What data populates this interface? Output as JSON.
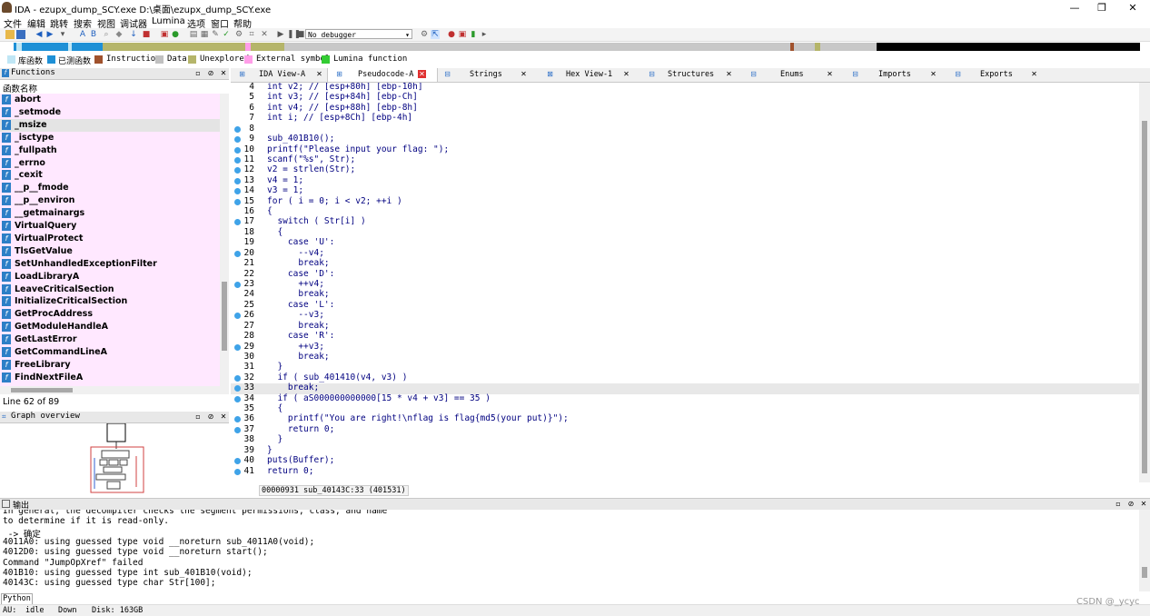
{
  "window": {
    "title": "IDA - ezupx_dump_SCY.exe D:\\桌面\\ezupx_dump_SCY.exe",
    "min": "—",
    "max": "❐",
    "close": "✕"
  },
  "menu": [
    "文件",
    "编辑",
    "跳转",
    "搜索",
    "视图",
    "调试器",
    "Lumina",
    "选项",
    "窗口",
    "帮助"
  ],
  "toolbar": {
    "debugger": "No debugger"
  },
  "legend": [
    {
      "label": "库函数",
      "color": "#bfe6f5"
    },
    {
      "label": "已测函数",
      "color": "#1e90d6"
    },
    {
      "label": "Instruction",
      "color": "#a0522d"
    },
    {
      "label": "Data",
      "color": "#c0c0c0"
    },
    {
      "label": "Unexplored",
      "color": "#b5b56a"
    },
    {
      "label": "External symbol",
      "color": "#ff9ee8"
    },
    {
      "label": "Lumina function",
      "color": "#33cc33"
    }
  ],
  "functions": {
    "title": "Functions",
    "column": "函数名称",
    "items": [
      "abort",
      "_setmode",
      "_msize",
      "_isctype",
      "_fullpath",
      "_errno",
      "_cexit",
      "__p__fmode",
      "__p__environ",
      "__getmainargs",
      "VirtualQuery",
      "VirtualProtect",
      "TlsGetValue",
      "SetUnhandledExceptionFilter",
      "LoadLibraryA",
      "LeaveCriticalSection",
      "InitializeCriticalSection",
      "GetProcAddress",
      "GetModuleHandleA",
      "GetLastError",
      "GetCommandLineA",
      "FreeLibrary",
      "FindNextFileA"
    ],
    "line_info": "Line 62 of 89"
  },
  "graph": {
    "title": "Graph overview"
  },
  "tabs": [
    "IDA View-A",
    "Pseudocode-A",
    "Strings",
    "Hex View-1",
    "Structures",
    "Enums",
    "Imports",
    "Exports"
  ],
  "code": {
    "lines": [
      {
        "n": "4",
        "t": "int v2; // [esp+80h] [ebp-10h]",
        "dot": false
      },
      {
        "n": "5",
        "t": "int v3; // [esp+84h] [ebp-Ch]",
        "dot": false
      },
      {
        "n": "6",
        "t": "int v4; // [esp+88h] [ebp-8h]",
        "dot": false
      },
      {
        "n": "7",
        "t": "int i; // [esp+8Ch] [ebp-4h]",
        "dot": false
      },
      {
        "n": "8",
        "t": "",
        "dot": true
      },
      {
        "n": "9",
        "t": "sub_401B10();",
        "dot": true
      },
      {
        "n": "10",
        "t": "printf(\"Please input your flag: \");",
        "dot": true
      },
      {
        "n": "11",
        "t": "scanf(\"%s\", Str);",
        "dot": true
      },
      {
        "n": "12",
        "t": "v2 = strlen(Str);",
        "dot": true
      },
      {
        "n": "13",
        "t": "v4 = 1;",
        "dot": true
      },
      {
        "n": "14",
        "t": "v3 = 1;",
        "dot": true
      },
      {
        "n": "15",
        "t": "for ( i = 0; i < v2; ++i )",
        "dot": true
      },
      {
        "n": "16",
        "t": "{",
        "dot": false
      },
      {
        "n": "17",
        "t": "  switch ( Str[i] )",
        "dot": true
      },
      {
        "n": "18",
        "t": "  {",
        "dot": false
      },
      {
        "n": "19",
        "t": "    case 'U':",
        "dot": false
      },
      {
        "n": "20",
        "t": "      --v4;",
        "dot": true
      },
      {
        "n": "21",
        "t": "      break;",
        "dot": false
      },
      {
        "n": "22",
        "t": "    case 'D':",
        "dot": false
      },
      {
        "n": "23",
        "t": "      ++v4;",
        "dot": true
      },
      {
        "n": "24",
        "t": "      break;",
        "dot": false
      },
      {
        "n": "25",
        "t": "    case 'L':",
        "dot": false
      },
      {
        "n": "26",
        "t": "      --v3;",
        "dot": true
      },
      {
        "n": "27",
        "t": "      break;",
        "dot": false
      },
      {
        "n": "28",
        "t": "    case 'R':",
        "dot": false
      },
      {
        "n": "29",
        "t": "      ++v3;",
        "dot": true
      },
      {
        "n": "30",
        "t": "      break;",
        "dot": false
      },
      {
        "n": "31",
        "t": "  }",
        "dot": false
      },
      {
        "n": "32",
        "t": "  if ( sub_401410(v4, v3) )",
        "dot": true
      },
      {
        "n": "33",
        "t": "    break;",
        "dot": true
      },
      {
        "n": "34",
        "t": "  if ( aS000000000000[15 * v4 + v3] == 35 )",
        "dot": true
      },
      {
        "n": "35",
        "t": "  {",
        "dot": false
      },
      {
        "n": "36",
        "t": "    printf(\"You are right!\\nflag is flag{md5(your put)}\");",
        "dot": true
      },
      {
        "n": "37",
        "t": "    return 0;",
        "dot": true
      },
      {
        "n": "38",
        "t": "  }",
        "dot": false
      },
      {
        "n": "39",
        "t": "}",
        "dot": false
      },
      {
        "n": "40",
        "t": "puts(Buffer);",
        "dot": true
      },
      {
        "n": "41",
        "t": "return 0;",
        "dot": true
      }
    ],
    "highlighted_line": "33",
    "status": "00000931 sub_40143C:33 (401531)"
  },
  "output": {
    "title": "输出",
    "lines": [
      "In general, the decompiler checks the segment permissions, class, and name",
      "to determine if it is read-only.",
      " -> 确定",
      "4011A0: using guessed type void __noreturn sub_4011A0(void);",
      "4012D0: using guessed type void __noreturn start();",
      "Command \"JumpOpXref\" failed",
      "401B10: using guessed type int sub_401B10(void);",
      "40143C: using guessed type char Str[100];"
    ],
    "python": "Python"
  },
  "statusbar": {
    "au": "AU:",
    "idle": "idle",
    "down": "Down",
    "disk": "Disk: 163GB"
  },
  "watermark": "CSDN @_ycyc"
}
